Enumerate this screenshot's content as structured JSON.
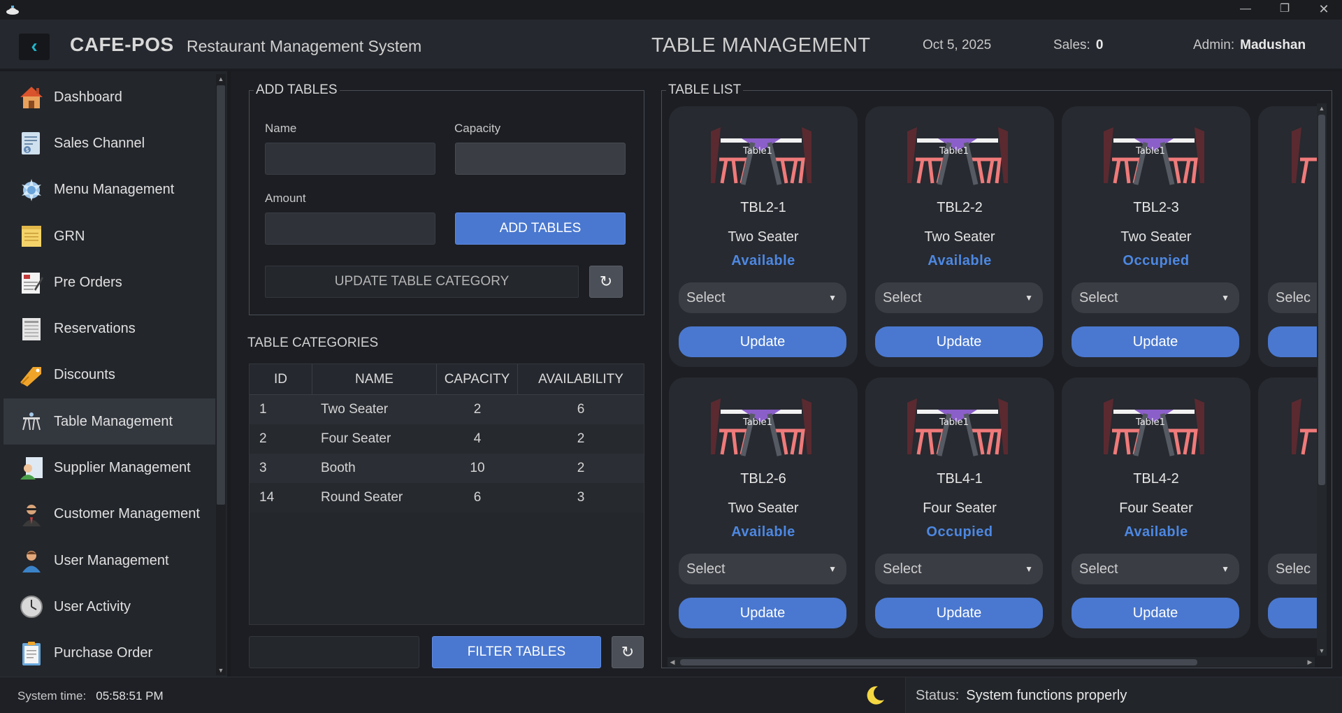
{
  "app": {
    "brand": "CAFE-POS",
    "subtitle": "Restaurant Management System"
  },
  "header": {
    "page_title": "TABLE MANAGEMENT",
    "date": "Oct 5, 2025",
    "sales_label": "Sales:",
    "sales_value": "0",
    "admin_label": "Admin:",
    "admin_name": "Madushan"
  },
  "sidebar": {
    "items": [
      {
        "label": "Dashboard",
        "icon": "home-icon"
      },
      {
        "label": "Sales Channel",
        "icon": "invoice-icon"
      },
      {
        "label": "Menu Management",
        "icon": "menu-icon"
      },
      {
        "label": "GRN",
        "icon": "notepad-icon"
      },
      {
        "label": "Pre Orders",
        "icon": "order-form-icon"
      },
      {
        "label": "Reservations",
        "icon": "ledger-icon"
      },
      {
        "label": "Discounts",
        "icon": "tag-icon"
      },
      {
        "label": "Table Management",
        "icon": "table-icon"
      },
      {
        "label": "Supplier Management",
        "icon": "supplier-icon"
      },
      {
        "label": "Customer Management",
        "icon": "customer-icon"
      },
      {
        "label": "User Management",
        "icon": "user-icon"
      },
      {
        "label": "User Activity",
        "icon": "clock-icon"
      },
      {
        "label": "Purchase Order",
        "icon": "clipboard-icon"
      }
    ],
    "active": "Table Management"
  },
  "add_tables": {
    "title": "ADD TABLES",
    "name_label": "Name",
    "name_value": "",
    "capacity_label": "Capacity",
    "capacity_value": "",
    "amount_label": "Amount",
    "amount_value": "",
    "add_button": "ADD TABLES",
    "update_category_button": "UPDATE TABLE CATEGORY"
  },
  "categories": {
    "title": "TABLE CATEGORIES",
    "columns": [
      "ID",
      "NAME",
      "CAPACITY",
      "AVAILABILITY"
    ],
    "rows": [
      {
        "id": "1",
        "name": "Two Seater",
        "capacity": "2",
        "availability": "6"
      },
      {
        "id": "2",
        "name": "Four Seater",
        "capacity": "4",
        "availability": "2"
      },
      {
        "id": "3",
        "name": "Booth",
        "capacity": "10",
        "availability": "2"
      },
      {
        "id": "14",
        "name": "Round Seater",
        "capacity": "6",
        "availability": "3"
      }
    ],
    "filter_value": "",
    "filter_button": "FILTER TABLES"
  },
  "table_list": {
    "title": "TABLE LIST",
    "image_label": "Table1",
    "select_placeholder": "Select",
    "partial_select": "Selec",
    "update_label": "Update",
    "tables": [
      {
        "code": "TBL2-1",
        "type": "Two Seater",
        "status": "Available"
      },
      {
        "code": "TBL2-2",
        "type": "Two Seater",
        "status": "Available"
      },
      {
        "code": "TBL2-3",
        "type": "Two Seater",
        "status": "Occupied"
      },
      {
        "code": "TBL2-6",
        "type": "Two Seater",
        "status": "Available"
      },
      {
        "code": "TBL4-1",
        "type": "Four Seater",
        "status": "Occupied"
      },
      {
        "code": "TBL4-2",
        "type": "Four Seater",
        "status": "Available"
      }
    ]
  },
  "statusbar": {
    "time_label": "System time:",
    "time_value": "05:58:51 PM",
    "status_label": "Status:",
    "status_value": "System functions properly"
  },
  "colors": {
    "accent": "#4a78d0",
    "status_text": "#4d88e3",
    "back_arrow": "#23b5c9",
    "moon": "#f5d742"
  }
}
